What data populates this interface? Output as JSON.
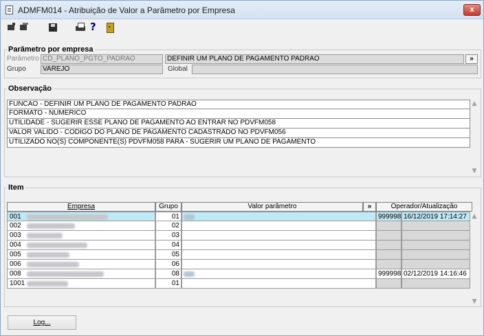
{
  "window": {
    "title": "ADMFM014 - Atribuição de Valor a Parâmetro por Empresa",
    "close_label": "x"
  },
  "toolbar": {
    "help_label": "?"
  },
  "parametro_group": {
    "legend": "Parâmetro por empresa",
    "parametro_label": "Parâmetro",
    "parametro_value": "CD_PLANO_PGTO_PADRAO",
    "descricao_value": "DEFINIR UM PLANO DE PAGAMENTO PADRAO",
    "expand_label": "»",
    "grupo_label": "Grupo",
    "grupo_value": "VAREJO",
    "global_label": "Global",
    "global_value": ""
  },
  "observacao_group": {
    "legend": "Observação",
    "lines": [
      "FUNCAO - DEFINIR UM PLANO DE PAGAMENTO PADRAO",
      "FORMATO - NUMERICO",
      "UTILIDADE - SUGERIR ESSE PLANO DE PAGAMENTO AO ENTRAR NO PDVFM058",
      "VALOR VALIDO - CODIGO DO PLANO DE PAGAMENTO CADASTRADO NO PDVFM056",
      "UTILIZADO NO(S) COMPONENTE(S) PDVFM058  PARA  - SUGERIR UM PLANO DE PAGAMENTO"
    ]
  },
  "item_group": {
    "legend": "Item",
    "columns": {
      "empresa": "Empresa",
      "grupo": "Grupo",
      "valor": "Valor parâmetro",
      "expand": "»",
      "operador": "Operador/Atualização"
    },
    "rows": [
      {
        "codigo": "001",
        "grupo": "01",
        "operador": "999998",
        "atualizacao": "16/12/2019 17:14:27"
      },
      {
        "codigo": "002",
        "grupo": "02",
        "operador": "",
        "atualizacao": ""
      },
      {
        "codigo": "003",
        "grupo": "03",
        "operador": "",
        "atualizacao": ""
      },
      {
        "codigo": "004",
        "grupo": "04",
        "operador": "",
        "atualizacao": ""
      },
      {
        "codigo": "005",
        "grupo": "05",
        "operador": "",
        "atualizacao": ""
      },
      {
        "codigo": "006",
        "grupo": "06",
        "operador": "",
        "atualizacao": ""
      },
      {
        "codigo": "008",
        "grupo": "08",
        "operador": "999998",
        "atualizacao": "02/12/2019 14:16:46"
      },
      {
        "codigo": "1001",
        "grupo": "01",
        "operador": "",
        "atualizacao": ""
      }
    ]
  },
  "footer": {
    "log_label": "Log..."
  },
  "icons": {
    "doc": "document-icon",
    "close": "close-icon",
    "nav_first": "nav-first-icon",
    "nav_last": "nav-last-icon",
    "save": "save-icon",
    "print": "print-icon",
    "help": "help-icon",
    "exit": "exit-door-icon"
  },
  "colors": {
    "selected_row": "#bfe9f7",
    "readonly_field": "#dcdcdc",
    "close_button": "#c53b2b"
  }
}
